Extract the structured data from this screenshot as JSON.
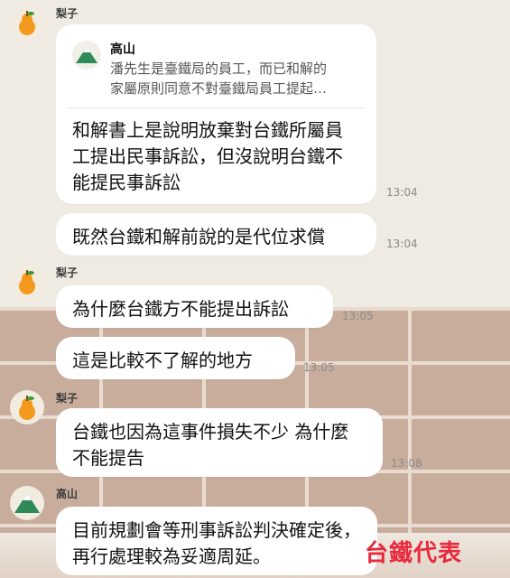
{
  "contacts": {
    "pear": "梨子",
    "mountain": "高山"
  },
  "messages": [
    {
      "quote": {
        "name": "高山",
        "text": "潘先生是臺鐵局的員工，而已和解的\n家屬原則同意不對臺鐵局員工提起…"
      },
      "text": "和解書上是說明放棄對台鐵所屬員工提出民事訴訟，但沒說明台鐵不能提民事訴訟",
      "time": "13:04"
    },
    {
      "text": "既然台鐵和解前說的是代位求償",
      "time": "13:04"
    },
    {
      "text": "為什麼台鐵方不能提出訴訟",
      "time": "13:05"
    },
    {
      "text": "這是比較不了解的地方",
      "time": "13:05"
    },
    {
      "text": "台鐵也因為這事件損失不少 為什麼不能提告",
      "time": "13:08"
    },
    {
      "text": "目前規劃會等刑事訴訟判決確定後，再行處理較為妥適周延。"
    }
  ],
  "watermark": "台鐵代表",
  "colors": {
    "pear_orange": "#f39a1e",
    "leaf_green": "#3a9a3a",
    "mountain_green": "#2e8b57",
    "watermark_red": "#e8283c"
  },
  "icons": [
    "pear-icon",
    "mountain-icon"
  ]
}
